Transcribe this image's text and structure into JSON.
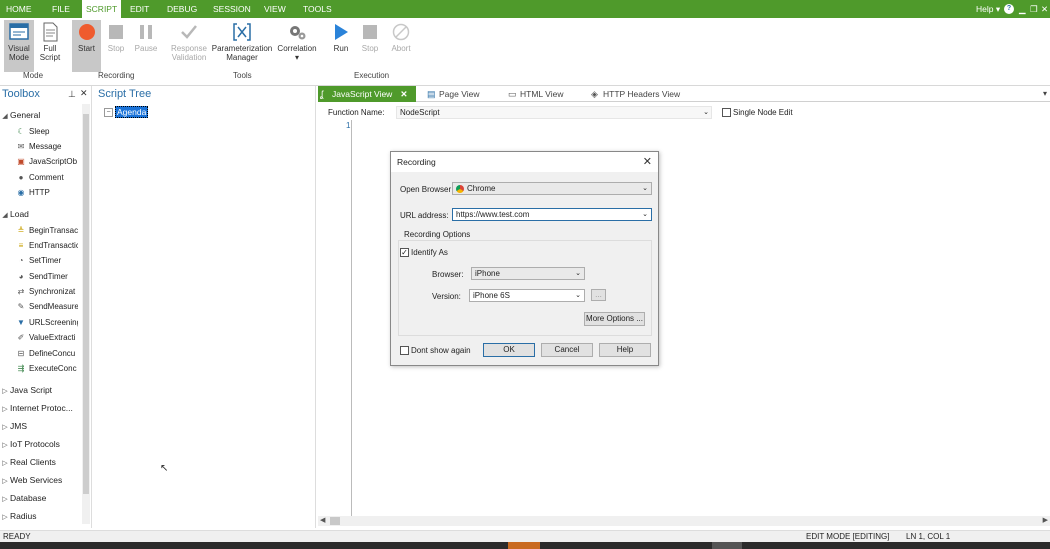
{
  "menubar": {
    "items": [
      "HOME",
      "FILE",
      "SCRIPT",
      "EDIT",
      "DEBUG",
      "SESSION",
      "VIEW",
      "TOOLS"
    ],
    "active": "SCRIPT",
    "help_label": "Help",
    "colors": {
      "accent": "#4f9a2b",
      "link": "#2a6ea6"
    }
  },
  "ribbon": {
    "visual_mode": "Visual Mode",
    "visual_mode_line1": "Visual",
    "visual_mode_line2": "Mode",
    "full_script_line1": "Full",
    "full_script_line2": "Script",
    "mode_group": "Mode",
    "start": "Start",
    "stop": "Stop",
    "pause": "Pause",
    "recording_group": "Recording",
    "response_validation_line1": "Response",
    "response_validation_line2": "Validation",
    "param_manager_line1": "Parameterization",
    "param_manager_line2": "Manager",
    "correlation": "Correlation",
    "tools_group": "Tools",
    "run": "Run",
    "stop_exec": "Stop",
    "abort": "Abort",
    "execution_group": "Execution"
  },
  "toolbox": {
    "title": "Toolbox",
    "sections": [
      {
        "label": "General",
        "expanded": true
      },
      {
        "label": "Load",
        "expanded": true
      },
      {
        "label": "Java Script",
        "expanded": false
      },
      {
        "label": "Internet Protoc...",
        "expanded": false
      },
      {
        "label": "JMS",
        "expanded": false
      },
      {
        "label": "IoT Protocols",
        "expanded": false
      },
      {
        "label": "Real Clients",
        "expanded": false
      },
      {
        "label": "Web Services",
        "expanded": false
      },
      {
        "label": "Database",
        "expanded": false
      },
      {
        "label": "Radius",
        "expanded": false
      }
    ],
    "general_items": [
      "Sleep",
      "Message",
      "JavaScriptOb",
      "Comment",
      "HTTP"
    ],
    "load_items": [
      "BeginTransac",
      "EndTransactic",
      "SetTimer",
      "SendTimer",
      "Synchronizat",
      "SendMeasure",
      "URLScreening",
      "ValueExtracti",
      "DefineConcu",
      "ExecuteConc"
    ]
  },
  "script_tree": {
    "title": "Script Tree",
    "root_node": "Agenda"
  },
  "editor": {
    "tabs": [
      "JavaScript View",
      "Page View",
      "HTML View",
      "HTTP Headers View"
    ],
    "active_tab": "JavaScript View",
    "function_name_label": "Function Name:",
    "function_name_value": "NodeScript",
    "single_node_edit": "Single Node Edit",
    "line_number": "1"
  },
  "dialog": {
    "title": "Recording",
    "open_browser_label": "Open Browser",
    "open_browser_value": "Chrome",
    "url_label": "URL address:",
    "url_value": "https://www.test.com",
    "recording_options_label": "Recording Options",
    "identify_as_label": "Identify As",
    "identify_as_checked": true,
    "browser_label": "Browser:",
    "browser_value": "iPhone",
    "version_label": "Version:",
    "version_value": "iPhone 6S",
    "ellipsis_button": "...",
    "more_options_button": "More Options ...",
    "dont_show_label": "Dont show again",
    "ok_button": "OK",
    "cancel_button": "Cancel",
    "help_button": "Help"
  },
  "statusbar": {
    "ready": "READY",
    "mode": "EDIT MODE [EDITING]",
    "position": "LN 1, COL 1"
  }
}
